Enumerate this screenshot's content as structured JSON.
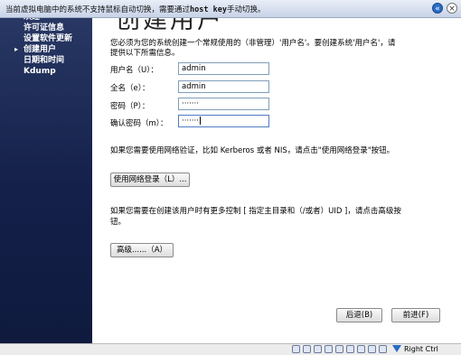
{
  "notice": {
    "text_before": "当前虚拟电脑中的系统不支持鼠标自动切换，需要通过",
    "key": "host key",
    "text_after": "手动切换。",
    "info_glyph": "«",
    "close_glyph": "×"
  },
  "sidebar": {
    "items": [
      {
        "label": "欢迎",
        "state": "done"
      },
      {
        "label": "许可证信息",
        "state": "done"
      },
      {
        "label": "设置软件更新",
        "state": "done"
      },
      {
        "label": "创建用户",
        "state": "current"
      },
      {
        "label": "日期和时间",
        "state": "todo"
      },
      {
        "label": "Kdump",
        "state": "todo"
      }
    ],
    "current_marker": "▸"
  },
  "main": {
    "title": "创建用户",
    "intro": "您必须为您的系统创建一个常规使用的（非管理）'用户名'。要创建系统'用户名'，请提供以下所需信息。",
    "fields": {
      "username": {
        "label": "用户名（U）：",
        "value": "admin"
      },
      "fullname": {
        "label": "全名（e）：",
        "value": "admin"
      },
      "password": {
        "label": "密码（P）：",
        "value": "·······"
      },
      "confirm": {
        "label": "确认密码（m）：",
        "value": "·······"
      }
    },
    "network_text": "如果您需要使用网络验证，比如 Kerberos 或者 NIS，请点击\"使用网络登录\"按钮。",
    "network_button": "使用网络登录（L）...",
    "advanced_text": "如果您需要在创建该用户时有更多控制 [ 指定主目录和（/或者）UID ]，请点击高级按钮。",
    "advanced_button": "高级......（A）",
    "back_button": "后退(B)",
    "forward_button": "前进(F)"
  },
  "statusbar": {
    "host_key": "Right Ctrl"
  },
  "colors": {
    "sidebar_top": "#2a3a66",
    "sidebar_bottom": "#0f1a3e",
    "input_border": "#7f9db9"
  }
}
